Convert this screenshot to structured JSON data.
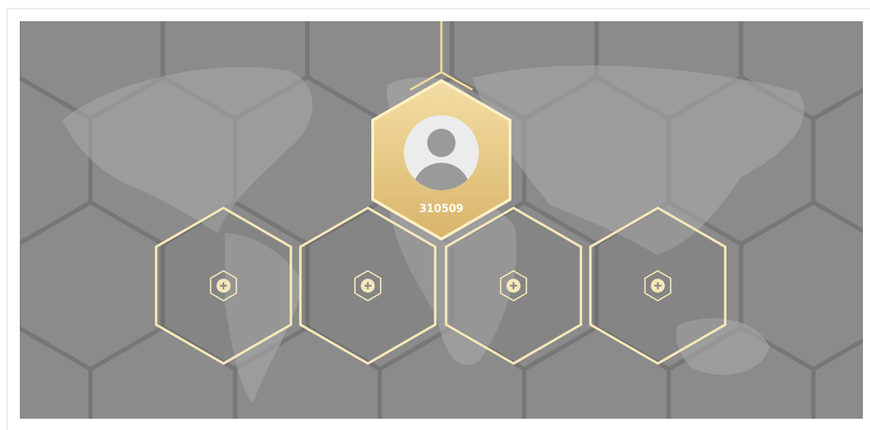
{
  "member": {
    "id": "310509"
  },
  "slots": [
    {
      "kind": "empty"
    },
    {
      "kind": "empty"
    },
    {
      "kind": "empty"
    },
    {
      "kind": "empty"
    }
  ]
}
